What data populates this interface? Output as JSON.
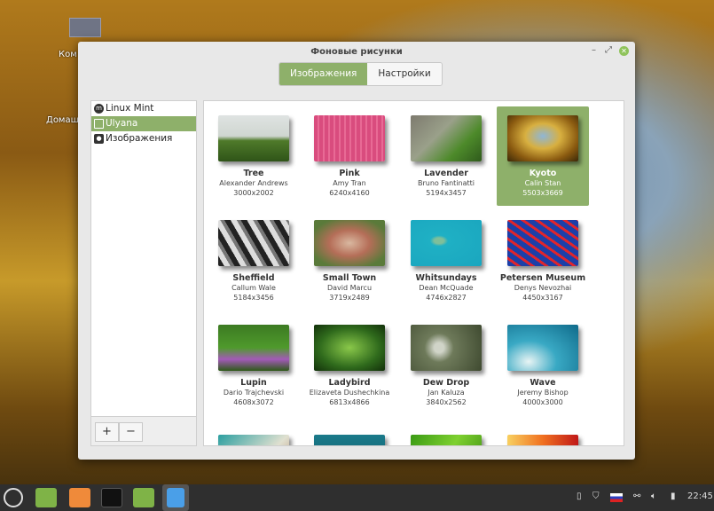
{
  "desktop": {
    "icons": [
      {
        "label": "Ком"
      },
      {
        "label": "Домаш"
      }
    ]
  },
  "window": {
    "title": "Фоновые рисунки",
    "tabs": [
      "Изображения",
      "Настройки"
    ],
    "minimize": "–",
    "maximize": "⤢",
    "close": "✕"
  },
  "sidebar": {
    "items": [
      {
        "label": "Linux Mint",
        "icon": "mint-logo-icon"
      },
      {
        "label": "Ulyana",
        "icon": "monitor-icon"
      },
      {
        "label": "Изображения",
        "icon": "camera-icon"
      }
    ],
    "selected": 1,
    "add": "+",
    "remove": "−"
  },
  "wallpapers": [
    {
      "name": "Tree",
      "author": "Alexander Andrews",
      "size": "3000x2002",
      "bg": "linear-gradient(#dfe3e2 0%,#cfd6d0 45%,#4f7a2a 55%,#2f5418 100%)"
    },
    {
      "name": "Pink",
      "author": "Amy Tran",
      "size": "6240x4160",
      "bg": "repeating-linear-gradient(90deg,#d94c7e 0 4px,#e86a95 4px 6px)"
    },
    {
      "name": "Lavender",
      "author": "Bruno Fantinatti",
      "size": "5194x3457",
      "bg": "linear-gradient(135deg,#7d7a6e,#9aa08a 40%,#4d8a2a 70%,#2f5a1c)"
    },
    {
      "name": "Kyoto",
      "author": "Calin Stan",
      "size": "5503x3669",
      "bg": "radial-gradient(ellipse at 50% 45%,#8fb6d6 0%,#d8b040 35%,#8a5a10 70%,#3a2808)"
    },
    {
      "name": "Sheffield",
      "author": "Callum Wale",
      "size": "5184x3456",
      "bg": "repeating-linear-gradient(60deg,#222 0 6px,#ddd 6px 12px,#777 12px 16px)"
    },
    {
      "name": "Small Town",
      "author": "David Marcu",
      "size": "3719x2489",
      "bg": "radial-gradient(ellipse at 50% 50%,#d9b8a0,#b56e58 40%,#5a7a3a 80%)"
    },
    {
      "name": "Whitsundays",
      "author": "Dean McQuade",
      "size": "4746x2827",
      "bg": "radial-gradient(ellipse at 40% 45%,#7fbf9a 0 8%,#1fb0c4 15%,#1aa6bf 100%)"
    },
    {
      "name": "Petersen Museum",
      "author": "Denys Nevozhai",
      "size": "4450x3167",
      "bg": "repeating-linear-gradient(35deg,#1c3fa8 0 6px,#e0252c 6px 9px)"
    },
    {
      "name": "Lupin",
      "author": "Dario Trajchevski",
      "size": "4608x3072",
      "bg": "linear-gradient(#3c7a22,#4f9a2c 50%,#a35ab8 75%,#2e5a18)"
    },
    {
      "name": "Ladybird",
      "author": "Elizaveta Dushechkina",
      "size": "6813x4866",
      "bg": "radial-gradient(ellipse at 50% 50%,#8ac84a,#2f6a1c 60%,#12300a)"
    },
    {
      "name": "Dew Drop",
      "author": "Jan Kaluza",
      "size": "3840x2562",
      "bg": "radial-gradient(circle at 40% 50%,#d0d4c8 0 10%,#6e7a5a 30%,#3f4a30)"
    },
    {
      "name": "Wave",
      "author": "Jeremy Bishop",
      "size": "4000x3000",
      "bg": "radial-gradient(ellipse at 30% 80%,#e8f4f4,#39a9c4 40%,#0f6a8a)"
    },
    {
      "name": "",
      "author": "",
      "size": "",
      "bg": "linear-gradient(135deg,#2c9fa0,#e0e0d0 60%,#b08060)"
    },
    {
      "name": "",
      "author": "",
      "size": "",
      "bg": "linear-gradient(#1a7a8a,#125a6a)"
    },
    {
      "name": "",
      "author": "",
      "size": "",
      "bg": "linear-gradient(120deg,#3a9a14,#7ed030,#3a8a10)"
    },
    {
      "name": "",
      "author": "",
      "size": "",
      "bg": "linear-gradient(90deg,#f8d060,#f07020,#c01818)"
    }
  ],
  "selected_wallpaper": 3,
  "taskbar": {
    "apps": [
      "menu",
      "files",
      "firefox",
      "terminal",
      "folder",
      "document"
    ],
    "clock": "22:45"
  }
}
